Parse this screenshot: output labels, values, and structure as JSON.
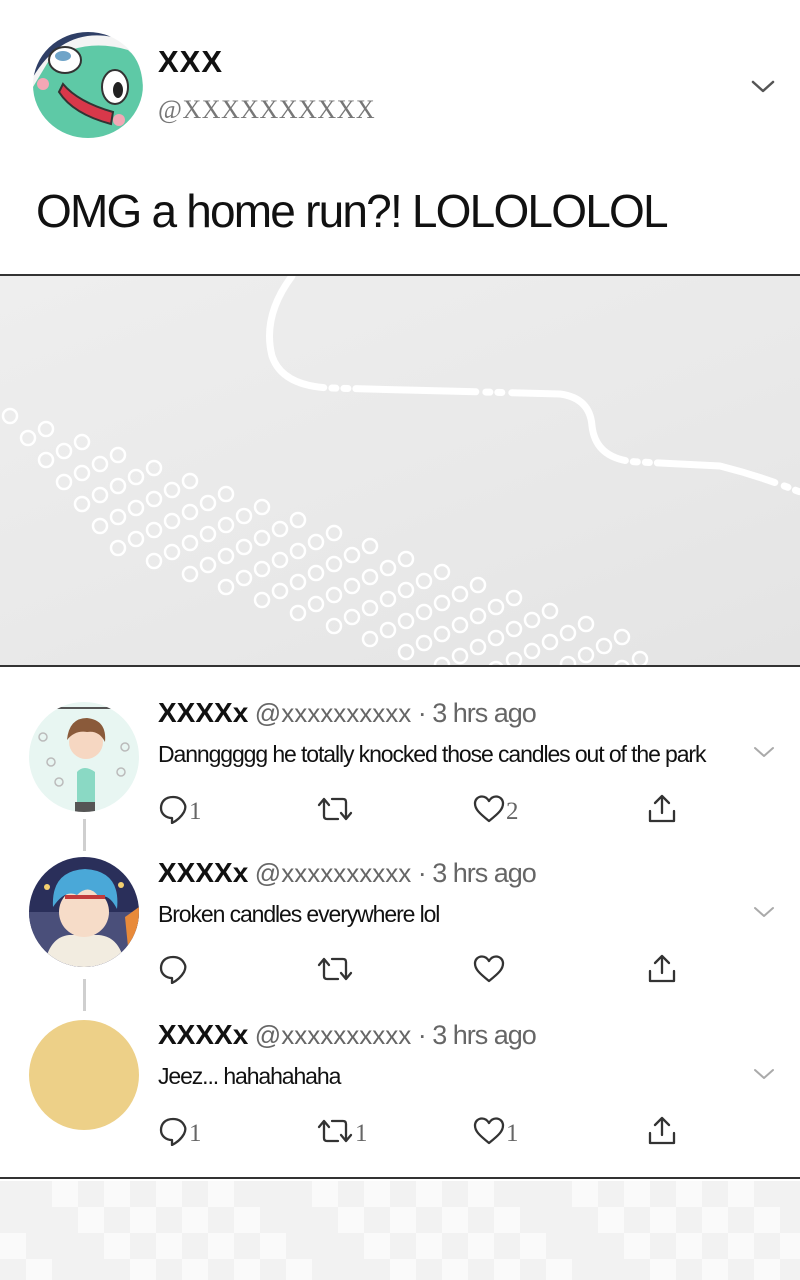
{
  "main_tweet": {
    "name": "XXX",
    "handle": "@XXXXXXXXXX",
    "text": "OMG a home run?! LOLOLOLOL",
    "avatar_icon": "fish-creature-avatar",
    "menu_icon": "chevron-down-icon"
  },
  "replies": [
    {
      "name": "XXXXx",
      "handle": "@xxxxxxxxxx",
      "separator": "·",
      "time": "3 hrs ago",
      "text": "Dannggggg he totally knocked those candles out of the park",
      "avatar_icon": "boy-character-avatar",
      "reply_count": "1",
      "retweet_count": "",
      "like_count": "2"
    },
    {
      "name": "XXXXx",
      "handle": "@xxxxxxxxxx",
      "separator": "·",
      "time": "3 hrs ago",
      "text": "Broken candles everywhere lol",
      "avatar_icon": "blue-hair-character-avatar",
      "reply_count": "",
      "retweet_count": "",
      "like_count": ""
    },
    {
      "name": "XXXXx",
      "handle": "@xxxxxxxxxx",
      "separator": "·",
      "time": "3 hrs ago",
      "text": "Jeez... hahahahaha",
      "avatar_icon": "yellow-circle-avatar",
      "reply_count": "1",
      "retweet_count": "1",
      "like_count": "1"
    }
  ],
  "colors": {
    "border": "#333333",
    "icon": "#333333",
    "muted_text": "#666666",
    "yellow_avatar": "#edd088",
    "media_bg": "#ebebeb"
  }
}
